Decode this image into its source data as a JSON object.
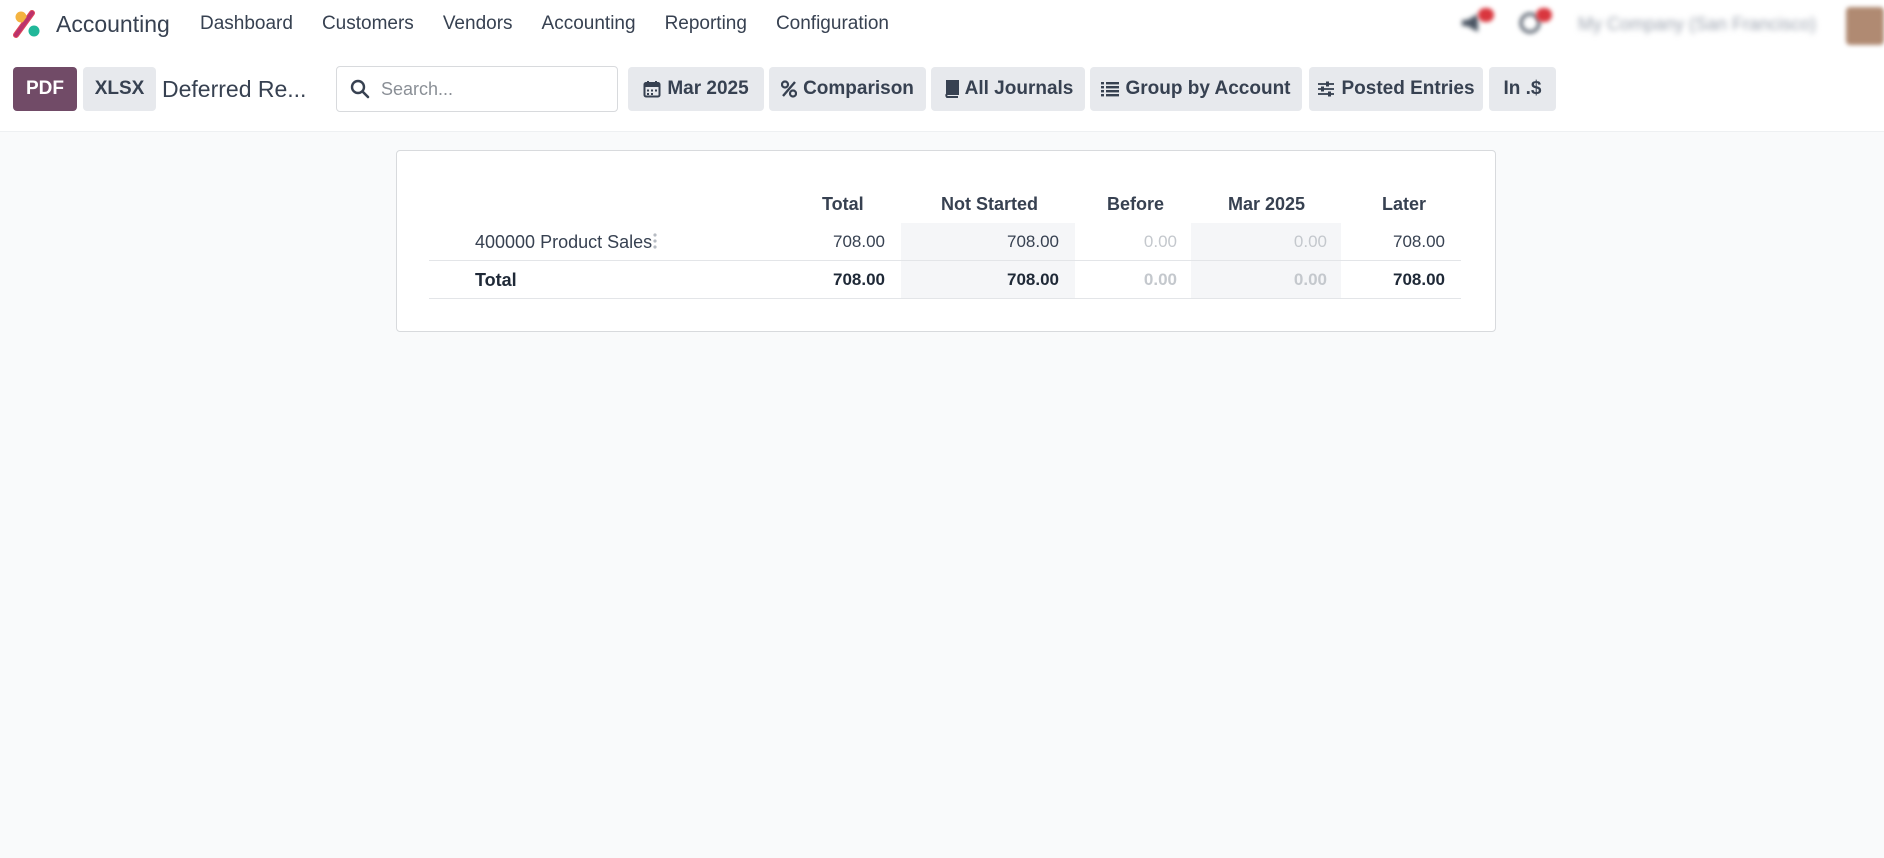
{
  "app": {
    "name": "Accounting",
    "colors": {
      "brand": "#714b67",
      "background": "#f9fafb",
      "button": "#e7e9ed"
    }
  },
  "menu": [
    "Dashboard",
    "Customers",
    "Vendors",
    "Accounting",
    "Reporting",
    "Configuration"
  ],
  "systray": {
    "icons": [
      "megaphone-icon",
      "clock-icon"
    ],
    "company": "My Company (San Francisco)",
    "avatar": "user-avatar"
  },
  "toolbar": {
    "pdf_label": "PDF",
    "xlsx_label": "XLSX",
    "report_title": "Deferred Re...",
    "search_placeholder": "Search...",
    "filters": [
      {
        "icon": "calendar-icon",
        "label": "Mar 2025"
      },
      {
        "icon": "percent-icon",
        "label": "Comparison"
      },
      {
        "icon": "book-icon",
        "label": "All Journals"
      },
      {
        "icon": "list-icon",
        "label": "Group by Account"
      },
      {
        "icon": "sliders-icon",
        "label": "Posted Entries"
      },
      {
        "icon": "",
        "label": "In .$"
      }
    ]
  },
  "report": {
    "columns": [
      "Total",
      "Not Started",
      "Before",
      "Mar 2025",
      "Later"
    ],
    "rows": [
      {
        "account": "400000 Product Sales",
        "values": [
          "708.00",
          "708.00",
          "0.00",
          "0.00",
          "708.00"
        ]
      }
    ],
    "total": {
      "label": "Total",
      "values": [
        "708.00",
        "708.00",
        "0.00",
        "0.00",
        "708.00"
      ]
    }
  }
}
